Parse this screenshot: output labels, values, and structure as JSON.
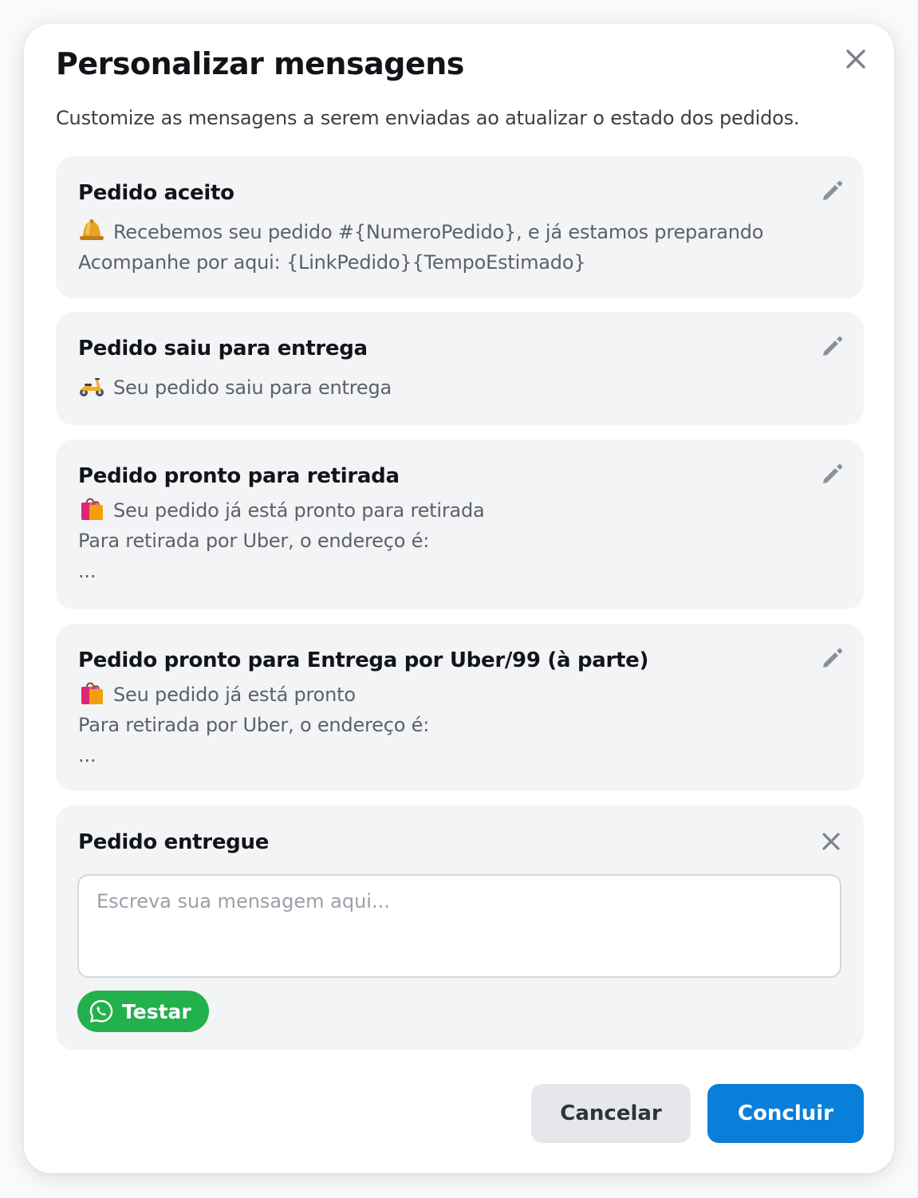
{
  "modal": {
    "title": "Personalizar mensagens",
    "subtitle": "Customize as mensagens a serem enviadas ao atualizar o estado dos pedidos.",
    "close_icon": "close-icon"
  },
  "cards": [
    {
      "title": "Pedido aceito",
      "emoji": "bell",
      "lines": [
        "Recebemos seu pedido #{NumeroPedido}, e já estamos preparando",
        "Acompanhe por aqui: {LinkPedido}{TempoEstimado}"
      ],
      "action_icon": "pencil-icon"
    },
    {
      "title": "Pedido saiu para entrega",
      "emoji": "scooter",
      "lines": [
        "Seu pedido saiu para entrega"
      ],
      "action_icon": "pencil-icon"
    },
    {
      "title": "Pedido pronto para retirada",
      "emoji": "shopping-bags",
      "lines": [
        "Seu pedido já está pronto para retirada",
        "Para retirada por Uber, o endereço é:",
        "..."
      ],
      "action_icon": "pencil-icon"
    },
    {
      "title": "Pedido pronto para Entrega por Uber/99 (à parte)",
      "emoji": "shopping-bags",
      "lines": [
        "Seu pedido já está pronto",
        "Para retirada por Uber, o endereço é:",
        "..."
      ],
      "action_icon": "pencil-icon"
    },
    {
      "title": "Pedido entregue",
      "input_value": "",
      "input_placeholder": "Escreva sua mensagem aqui...",
      "test_button_label": "Testar",
      "test_button_icon": "whatsapp-icon",
      "action_icon": "close-icon"
    }
  ],
  "footer": {
    "cancel_label": "Cancelar",
    "confirm_label": "Concluir"
  },
  "colors": {
    "accent": "#0A7FD9",
    "whatsapp_green": "#22B14C",
    "card_background": "#F3F4F6"
  }
}
